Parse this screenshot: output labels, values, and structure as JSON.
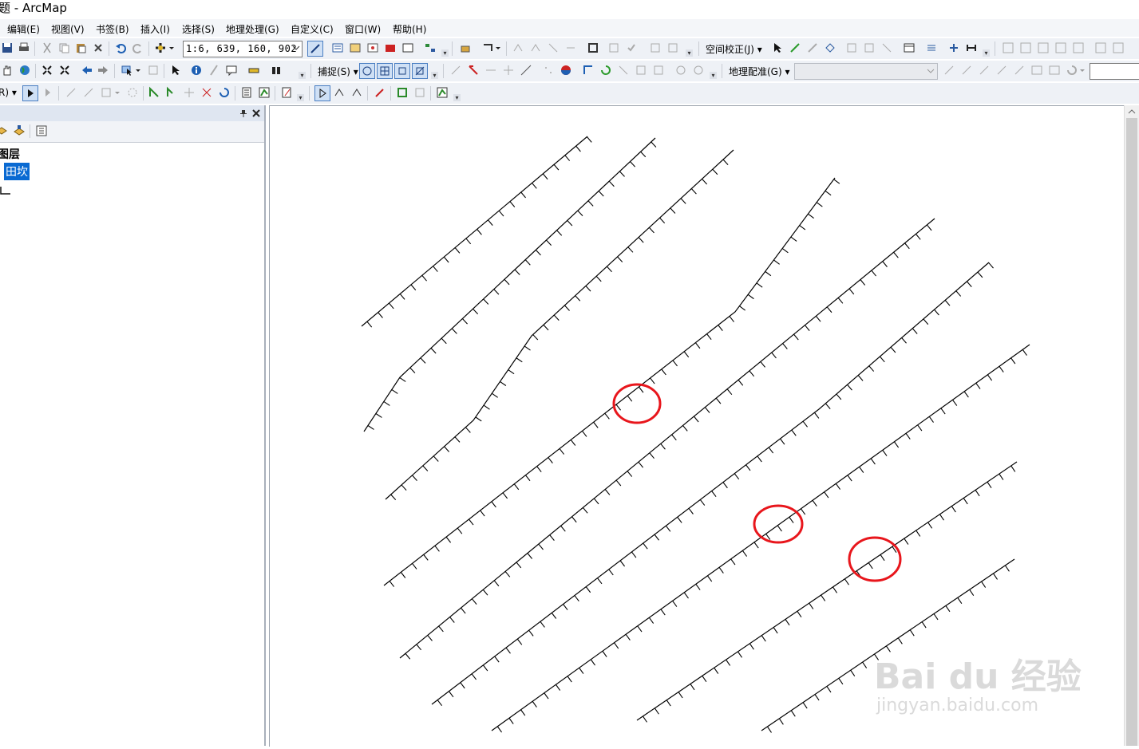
{
  "window": {
    "title": "题 - ArcMap"
  },
  "menu": [
    "编辑(E)",
    "视图(V)",
    "书签(B)",
    "插入(I)",
    "选择(S)",
    "地理处理(G)",
    "自定义(C)",
    "窗口(W)",
    "帮助(H)"
  ],
  "toolbar": {
    "scale_value": "1:6, 639, 160, 902",
    "spatial_adjust_label": "空间校正(J) ▾",
    "snap_label": "捕捉(S) ▾",
    "georef_label": "地理配准(G) ▾",
    "editor_label": "R) ▾"
  },
  "toc": {
    "pin_icon": "pin-icon",
    "close_icon": "close-icon",
    "root_label": "图层",
    "layer_label": "田坎"
  },
  "watermark": {
    "brand": "Bai du 经验",
    "url": "jingyan.baidu.com"
  },
  "map": {
    "annotation_color": "#e8161c",
    "line_color": "#000000"
  }
}
